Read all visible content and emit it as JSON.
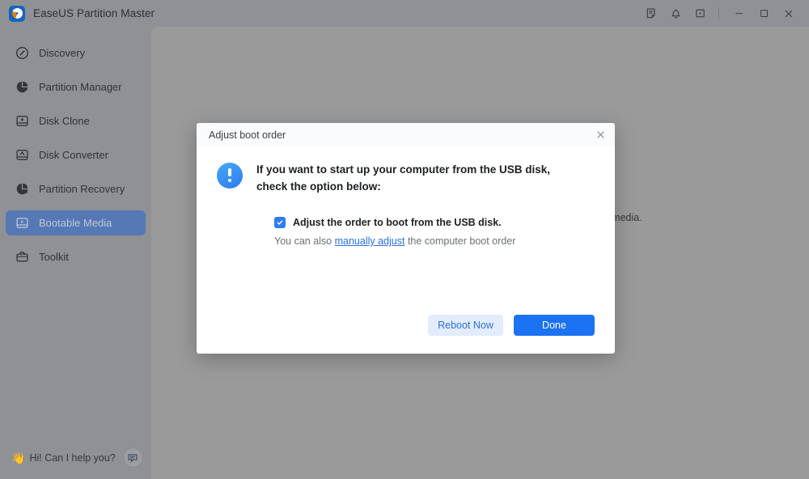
{
  "window": {
    "title": "EaseUS Partition Master",
    "logo_icon": "easeus-logo-icon",
    "controls": {
      "feedback_icon": "feedback-note-icon",
      "notification_icon": "bell-icon",
      "more_icon": "square-dot-icon",
      "minimize_icon": "minimize-icon",
      "maximize_icon": "maximize-icon",
      "close_icon": "close-icon"
    }
  },
  "sidebar": {
    "items": [
      {
        "label": "Discovery",
        "icon": "compass-icon",
        "active": false
      },
      {
        "label": "Partition Manager",
        "icon": "pie-chart-icon",
        "active": false
      },
      {
        "label": "Disk Clone",
        "icon": "disk-plus-icon",
        "active": false
      },
      {
        "label": "Disk Converter",
        "icon": "disk-convert-icon",
        "active": false
      },
      {
        "label": "Partition Recovery",
        "icon": "pie-recovery-icon",
        "active": false
      },
      {
        "label": "Bootable Media",
        "icon": "bootable-disk-icon",
        "active": true
      },
      {
        "label": "Toolkit",
        "icon": "briefcase-icon",
        "active": false
      }
    ],
    "help": {
      "wave_emoji": "👋",
      "text": "Hi! Can I help you?",
      "chat_icon": "chat-bubble-icon"
    }
  },
  "main": {
    "background_text": "ble media."
  },
  "dialog": {
    "title": "Adjust boot order",
    "close_icon": "close-icon",
    "info_icon": "info-exclamation-icon",
    "headline": "If you want to start up your computer from the USB disk, check the option below:",
    "checkbox": {
      "checked": true,
      "check_icon": "checkmark-icon",
      "label": "Adjust the order to boot from the USB disk."
    },
    "sub_text_before": "You can also ",
    "sub_link": "manually adjust",
    "sub_text_after": " the computer boot order",
    "buttons": {
      "secondary": "Reboot Now",
      "primary": "Done"
    }
  },
  "colors": {
    "accent_blue": "#1b72f2",
    "secondary_blue_bg": "#e3ecfd",
    "link_blue": "#2b6fe0",
    "sidebar_active": "#5678b4",
    "overlay_gray": "#9a9a9a"
  }
}
